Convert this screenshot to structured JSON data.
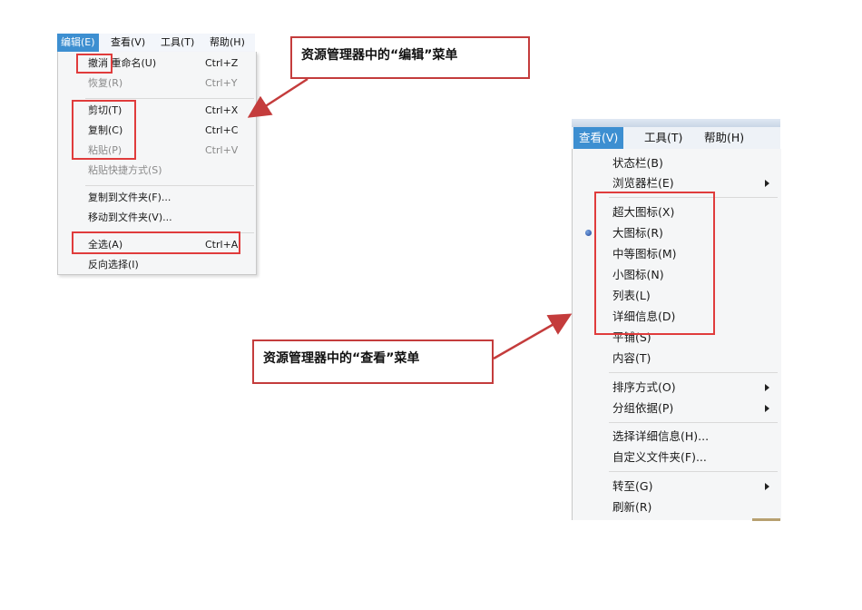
{
  "edit_panel": {
    "menubar": [
      {
        "label": "编辑(E)",
        "active": true
      },
      {
        "label": "查看(V)",
        "active": false
      },
      {
        "label": "工具(T)",
        "active": false
      },
      {
        "label": "帮助(H)",
        "active": false
      }
    ],
    "items": [
      {
        "label": "撤消 重命名(U)",
        "shortcut": "Ctrl+Z",
        "disabled": false
      },
      {
        "label": "恢复(R)",
        "shortcut": "Ctrl+Y",
        "disabled": true
      },
      {
        "label": "剪切(T)",
        "shortcut": "Ctrl+X",
        "disabled": false
      },
      {
        "label": "复制(C)",
        "shortcut": "Ctrl+C",
        "disabled": false
      },
      {
        "label": "粘贴(P)",
        "shortcut": "Ctrl+V",
        "disabled": true
      },
      {
        "label": "粘贴快捷方式(S)",
        "shortcut": "",
        "disabled": true
      },
      {
        "label": "复制到文件夹(F)...",
        "shortcut": "",
        "disabled": false
      },
      {
        "label": "移动到文件夹(V)...",
        "shortcut": "",
        "disabled": false
      },
      {
        "label": "全选(A)",
        "shortcut": "Ctrl+A",
        "disabled": false
      },
      {
        "label": "反向选择(I)",
        "shortcut": "",
        "disabled": false
      }
    ]
  },
  "view_panel": {
    "menubar": [
      {
        "label": "查看(V)",
        "active": true
      },
      {
        "label": "工具(T)",
        "active": false
      },
      {
        "label": "帮助(H)",
        "active": false
      }
    ],
    "items": [
      {
        "label": "状态栏(B)",
        "has_submenu": false
      },
      {
        "label": "浏览器栏(E)",
        "has_submenu": true
      },
      {
        "label": "超大图标(X)",
        "has_submenu": false
      },
      {
        "label": "大图标(R)",
        "has_submenu": false,
        "selected": true
      },
      {
        "label": "中等图标(M)",
        "has_submenu": false
      },
      {
        "label": "小图标(N)",
        "has_submenu": false
      },
      {
        "label": "列表(L)",
        "has_submenu": false
      },
      {
        "label": "详细信息(D)",
        "has_submenu": false
      },
      {
        "label": "平铺(S)",
        "has_submenu": false
      },
      {
        "label": "内容(T)",
        "has_submenu": false
      },
      {
        "label": "排序方式(O)",
        "has_submenu": true
      },
      {
        "label": "分组依据(P)",
        "has_submenu": true
      },
      {
        "label": "选择详细信息(H)...",
        "has_submenu": false
      },
      {
        "label": "自定义文件夹(F)...",
        "has_submenu": false
      },
      {
        "label": "转至(G)",
        "has_submenu": true
      },
      {
        "label": "刷新(R)",
        "has_submenu": false
      }
    ]
  },
  "callouts": {
    "edit_menu": "资源管理器中的“编辑”菜单",
    "view_menu": "资源管理器中的“查看”菜单"
  },
  "colors": {
    "highlight_border": "#e03c3c",
    "menubar_active": "#3d8fd1",
    "arrow": "#c43c3c"
  }
}
